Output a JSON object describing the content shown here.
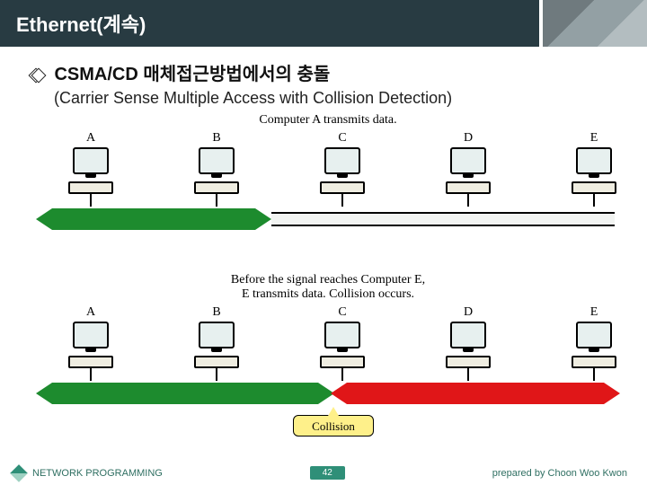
{
  "titlebar": {
    "title": "Ethernet(계속)"
  },
  "heading": {
    "text": "CSMA/CD 매체접근방법에서의 충돌",
    "subtitle": "(Carrier Sense Multiple Access with Collision Detection)"
  },
  "diagram": {
    "caption_top": "Computer A transmits data.",
    "caption_bottom": "Before the signal reaches Computer E,\nE transmits data. Collision occurs.",
    "computers": {
      "A": "A",
      "B": "B",
      "C": "C",
      "D": "D",
      "E": "E"
    },
    "collision_label": "Collision"
  },
  "footer": {
    "left": "NETWORK PROGRAMMING",
    "page": "42",
    "right": "prepared by Choon Woo Kwon"
  }
}
